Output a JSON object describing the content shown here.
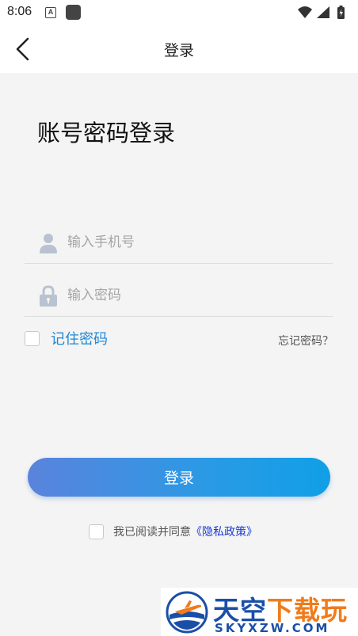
{
  "status_bar": {
    "time": "8:06",
    "a_badge": "A"
  },
  "navbar": {
    "title": "登录",
    "back_icon": "chevron-left-icon"
  },
  "heading": "账号密码登录",
  "phone_field": {
    "placeholder": "输入手机号",
    "value": "",
    "icon": "user-icon"
  },
  "password_field": {
    "placeholder": "输入密码",
    "value": "",
    "icon": "lock-icon"
  },
  "remember": {
    "label": "记住密码",
    "checked": false
  },
  "forgot_label": "忘记密码？",
  "login_button": "登录",
  "agreement": {
    "prefix": "我已阅读并同意",
    "link": "《隐私政策》",
    "checked": false
  },
  "watermark": {
    "title_blue": "天空",
    "title_orange": "下载玩",
    "subtitle": "SKYXZW.COM"
  },
  "colors": {
    "accent": "#1e88d8",
    "link": "#1a3ad1",
    "button_start": "#5a83dc",
    "button_end": "#109fe6",
    "watermark_blue": "#1a4fa8",
    "watermark_orange": "#f07b1a"
  }
}
